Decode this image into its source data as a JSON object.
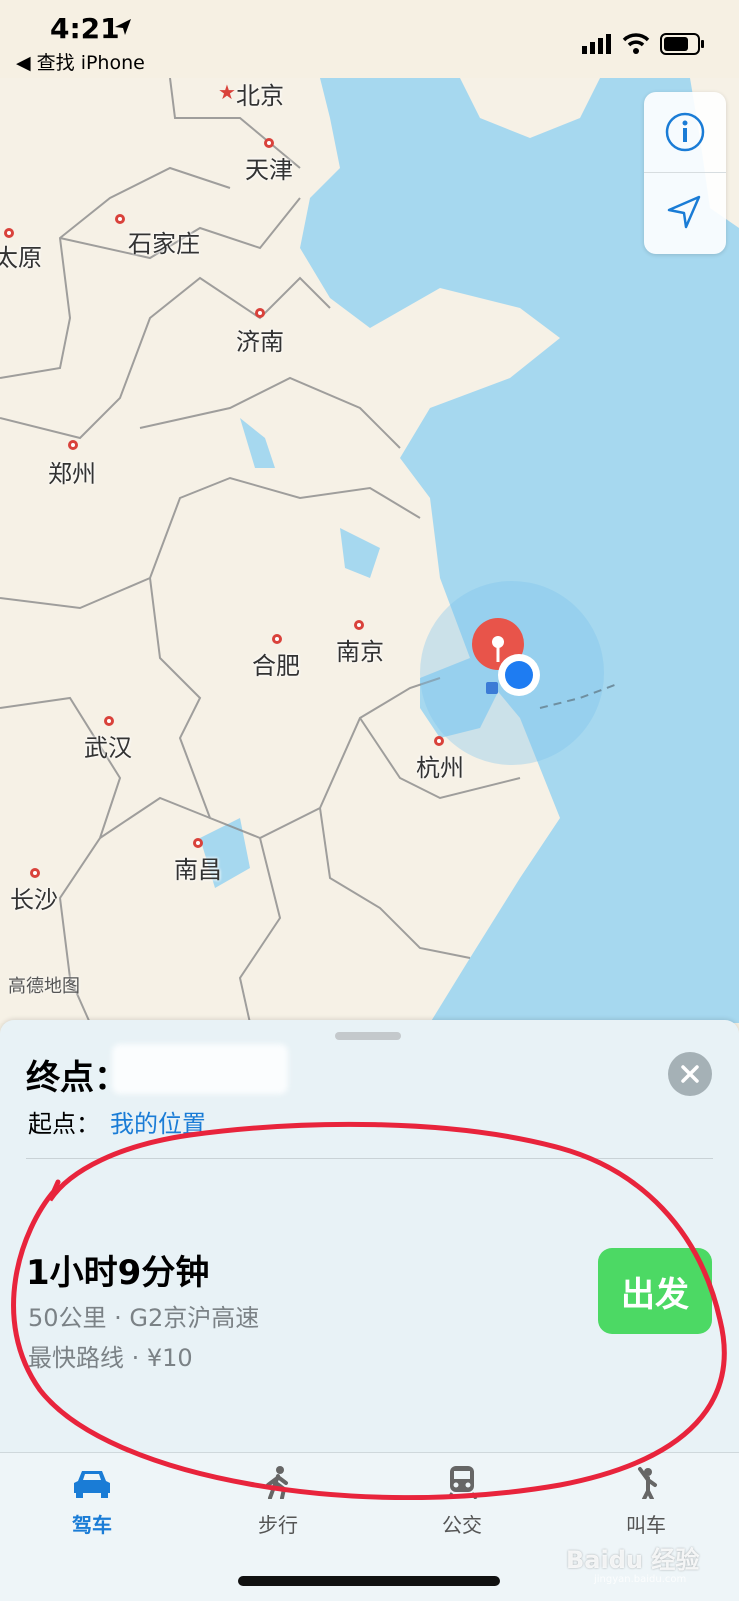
{
  "status_bar": {
    "time": "4:21",
    "back_app": "◀ 查找 iPhone"
  },
  "map": {
    "attribution": "高德地图",
    "cities": [
      "北京",
      "天津",
      "石家庄",
      "太原",
      "济南",
      "郑州",
      "合肥",
      "南京",
      "杭州",
      "武汉",
      "南昌",
      "长沙"
    ]
  },
  "map_controls": {
    "info_icon": "info-icon",
    "location_icon": "location-arrow-icon"
  },
  "sheet": {
    "destination_label": "终点：",
    "origin_label": "起点：",
    "origin_value": "我的位置",
    "route_time": "1小时9分钟",
    "route_detail": "50公里 · G2京沪高速",
    "route_extra": "最快路线 · ¥10",
    "go_label": "出发"
  },
  "tabs": [
    {
      "label": "驾车",
      "icon": "car-icon",
      "active": true
    },
    {
      "label": "步行",
      "icon": "walk-icon",
      "active": false
    },
    {
      "label": "公交",
      "icon": "train-icon",
      "active": false
    },
    {
      "label": "叫车",
      "icon": "hail-icon",
      "active": false
    }
  ],
  "colors": {
    "accent": "#1a7cd6",
    "go_button": "#4cd964",
    "sea": "#a6d8ef",
    "land": "#f6f1e6",
    "annotation": "#e8243c"
  },
  "watermark": {
    "brand": "Baidu 经验",
    "url": "jingyan.baidu.com"
  }
}
